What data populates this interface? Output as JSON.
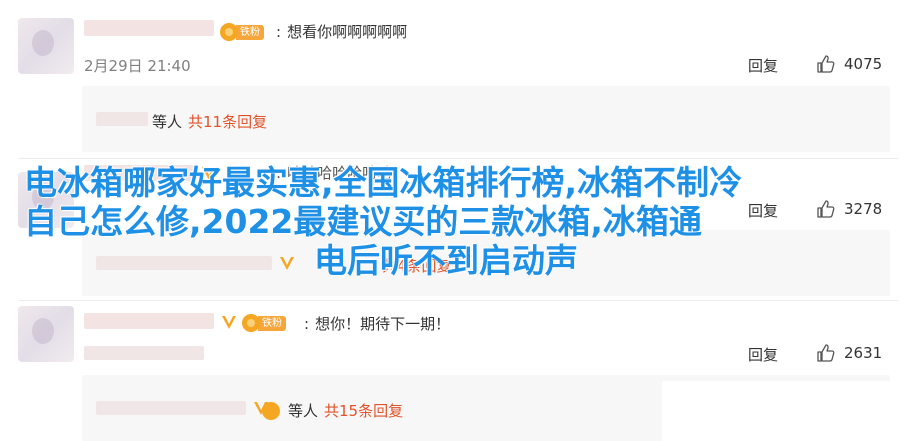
{
  "comments": [
    {
      "text": "想看你啊啊啊啊啊",
      "timestamp": "2月29日 21:40",
      "reply_label": "回复",
      "likes": "4075",
      "fan_badge": "铁粉",
      "sub_reply": {
        "who": "等人",
        "count_label": "共11条回复"
      }
    },
    {
      "text": "哈哈哈哈哈哈哈",
      "reply_label": "回复",
      "likes": "3278",
      "sub_reply": {
        "count_label": "共4条回复"
      }
    },
    {
      "text": "想你！期待下一期！",
      "reply_label": "回复",
      "likes": "2631",
      "fan_badge": "铁粉",
      "sub_reply": {
        "who": "等人",
        "count_label": "共15条回复"
      }
    }
  ],
  "overlay": {
    "line1": "电冰箱哪家好最实惠,全国冰箱排行榜,冰箱不制冷",
    "line2": "自己怎么修,2022最建议买的三款冰箱,冰箱通",
    "line3": "电后听不到启动声"
  },
  "colors": {
    "accent_red": "#e0532b",
    "overlay_blue": "#1e90e6",
    "badge_orange": "#f7a63b"
  },
  "icons": [
    "avatar",
    "vip-v-icon",
    "fan-medal-icon",
    "thumbs-up-icon"
  ]
}
